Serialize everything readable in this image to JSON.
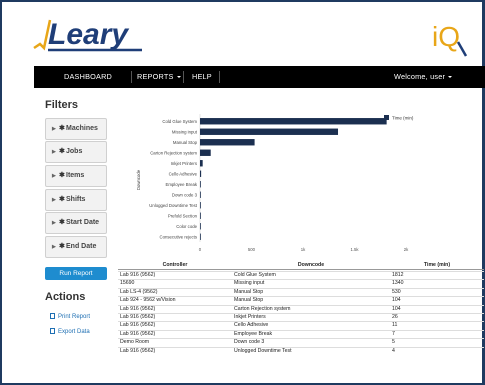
{
  "header": {
    "logo_text": "Leary",
    "brand_mark": "iQ"
  },
  "navbar": {
    "items": [
      {
        "label": "DASHBOARD"
      },
      {
        "label": "REPORTS"
      },
      {
        "label": "HELP"
      }
    ],
    "welcome": "Welcome, user"
  },
  "filters": {
    "title": "Filters",
    "items": [
      {
        "label": "Machines"
      },
      {
        "label": "Jobs"
      },
      {
        "label": "Items"
      },
      {
        "label": "Shifts"
      },
      {
        "label": "Start Date"
      },
      {
        "label": "End Date"
      }
    ],
    "run_label": "Run Report"
  },
  "actions": {
    "title": "Actions",
    "items": [
      {
        "label": "Print Report"
      },
      {
        "label": "Export Data"
      }
    ]
  },
  "chart_data": {
    "type": "bar",
    "orientation": "horizontal",
    "categories": [
      "Cold Glue System",
      "Missing input",
      "Manual Stop",
      "Carton Rejection system",
      "Inkjet Printers",
      "Cello Adhesive",
      "Employee Break",
      "Down code 3",
      "Unlogged Downtime Test",
      "Prefold Section",
      "Color code",
      "Consecutive rejects"
    ],
    "series": [
      {
        "name": "Time (min)",
        "values": [
          1812,
          1340,
          530,
          104,
          26,
          11,
          7,
          5,
          4,
          2,
          1,
          1
        ]
      }
    ],
    "xticks": [
      "0",
      "500",
      "1k",
      "1.5k",
      "2k"
    ],
    "xlim": [
      0,
      2000
    ],
    "ylabel": "Downcode",
    "legend_position": "top-right",
    "color": "#1b2f50"
  },
  "table": {
    "headers": [
      "Controller",
      "Downcode",
      "Time (min)"
    ],
    "rows": [
      [
        "Lab 916 (9562)",
        "Cold Glue System",
        "1812"
      ],
      [
        "15690",
        "Missing input",
        "1340"
      ],
      [
        "Lab LS-4 (9562)",
        "Manual Stop",
        "530"
      ],
      [
        "Lab 924 - 9562 w/Vision",
        "Manual Stop",
        "104"
      ],
      [
        "Lab 916 (9562)",
        "Carton Rejection system",
        "104"
      ],
      [
        "Lab 916 (9562)",
        "Inkjet Printers",
        "26"
      ],
      [
        "Lab 916 (9562)",
        "Cello Adhesive",
        "11"
      ],
      [
        "Lab 916 (9562)",
        "Employee Break",
        "7"
      ],
      [
        "Demo Room",
        "Down code 3",
        "5"
      ],
      [
        "Lab 916 (9562)",
        "Unlogged Downtime Test",
        "4"
      ]
    ]
  }
}
